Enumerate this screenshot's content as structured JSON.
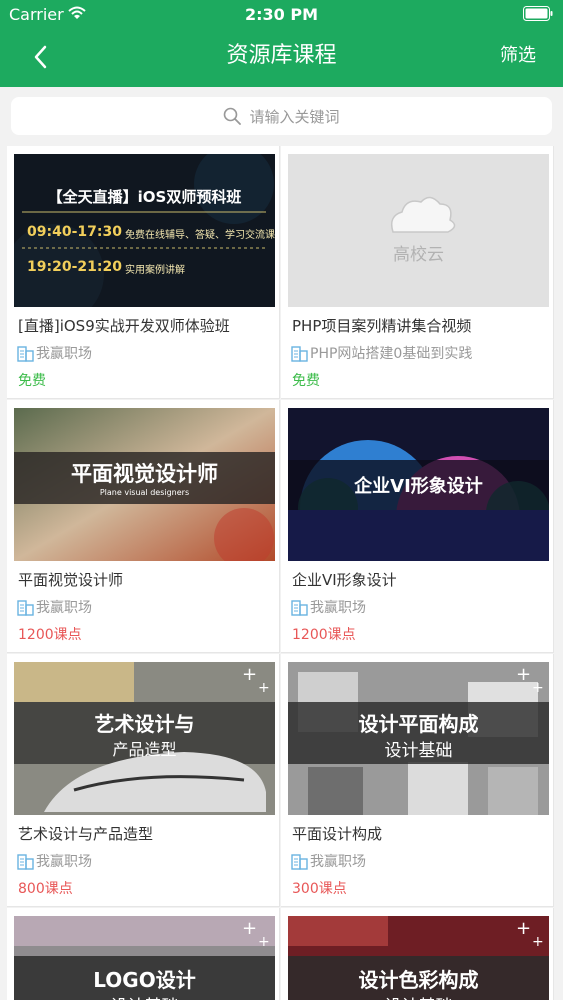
{
  "status_bar": {
    "carrier": "Carrier",
    "time": "2:30 PM"
  },
  "nav": {
    "title": "资源库课程",
    "filter_label": "筛选"
  },
  "search": {
    "placeholder": "请输入关键词"
  },
  "courses": [
    {
      "title": "[直播]iOS9实战开发双师体验班",
      "provider": "我赢职场",
      "price": "免费",
      "thumb": {
        "heading": "【全天直播】iOS双师预科班",
        "row1_time": "09:40-17:30",
        "row1_text": "免费在线辅导、答疑、学习交流课",
        "row2_time": "19:20-21:20",
        "row2_text": "实用案例讲解"
      }
    },
    {
      "title": "PHP项目案列精讲集合视频",
      "provider": "PHP网站搭建0基础到实践",
      "price": "免费",
      "thumb": {
        "logo_text": "高校云"
      }
    },
    {
      "title": "平面视觉设计师",
      "provider": "我赢职场",
      "price": "1200课点",
      "thumb": {
        "heading": "平面视觉设计师",
        "sub": "Plane visual designers"
      }
    },
    {
      "title": "企业VI形象设计",
      "provider": "我赢职场",
      "price": "1200课点",
      "thumb": {
        "heading": "企业VI形象设计"
      }
    },
    {
      "title": "艺术设计与产品造型",
      "provider": "我赢职场",
      "price": "800课点",
      "thumb": {
        "line1": "艺术设计与",
        "line2": "产品造型"
      }
    },
    {
      "title": "平面设计构成",
      "provider": "我赢职场",
      "price": "300课点",
      "thumb": {
        "line1": "设计平面构成",
        "line2": "设计基础"
      }
    },
    {
      "thumb": {
        "line1": "LOGO设计",
        "line2": "设计基础"
      }
    },
    {
      "thumb": {
        "line1": "设计色彩构成",
        "line2": "设计基础"
      }
    }
  ],
  "icons": {
    "back": "chevron-left-icon",
    "search": "search-icon",
    "provider": "building-icon",
    "wifi": "wifi-icon",
    "battery": "battery-icon",
    "cloud": "cloud-icon"
  },
  "colors": {
    "brand": "#1daa5f",
    "free": "#3dbc4b",
    "paid": "#e85757"
  }
}
